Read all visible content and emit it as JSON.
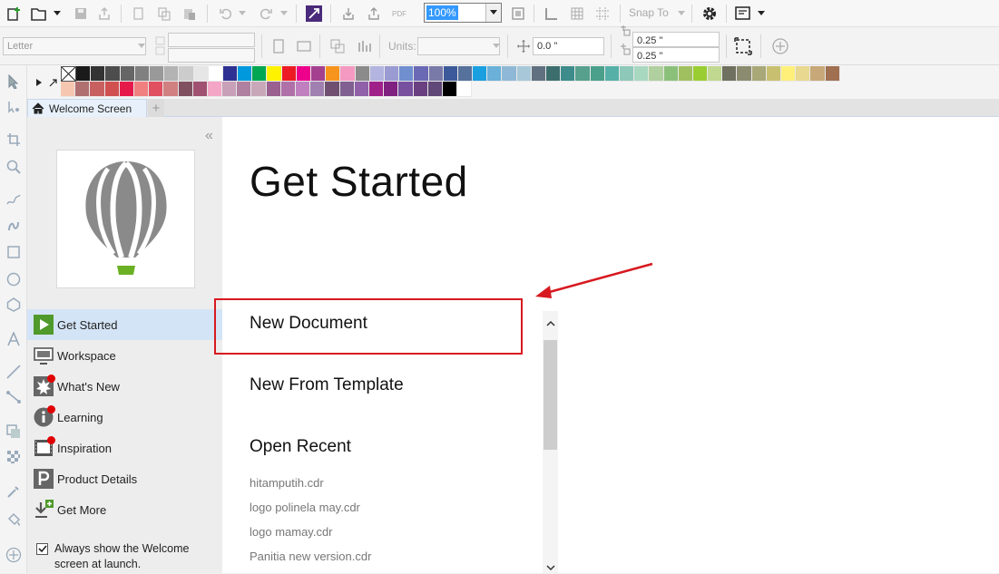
{
  "toolbar": {
    "zoom_value": "100%",
    "snap_to": "Snap To",
    "pdf_label": "PDF"
  },
  "property_bar": {
    "page_size": "Letter",
    "units_label": "Units:",
    "rotation": "0.0 \"",
    "nudge_x": "0.25 \"",
    "nudge_y": "0.25 \""
  },
  "palette": {
    "row1": [
      "#1a1a1a",
      "#333333",
      "#4d4d4d",
      "#666666",
      "#808080",
      "#999999",
      "#b3b3b3",
      "#cccccc",
      "#e6e6e6",
      "#ffffff",
      "#2e3192",
      "#0099dd",
      "#00a651",
      "#fff200",
      "#ed1c24",
      "#ec008c",
      "#a3418f",
      "#f7941d",
      "#f49ac1",
      "#8b8b8b",
      "#b4b4e0",
      "#9b9bd3",
      "#6f8fcf",
      "#6a6ab4",
      "#7a7aa8",
      "#3c5a99",
      "#56719b",
      "#1aa0e0",
      "#6ab0d8",
      "#8fb8d6",
      "#a8c8d8",
      "#607080",
      "#3c6e6e",
      "#3d8b8b",
      "#56a08d",
      "#4aa08a",
      "#56b0a8",
      "#8dc8b8",
      "#a8d8c0",
      "#b0d0a0",
      "#8bc07a",
      "#a0c060",
      "#9acd32",
      "#c0d890",
      "#707060",
      "#8b8b70",
      "#a8a878",
      "#c8c070",
      "#fff07a",
      "#e8d890",
      "#c8a878",
      "#a07050"
    ],
    "row2": [
      "#f6c7b0",
      "#b07070",
      "#c86060",
      "#d05050",
      "#e6194b",
      "#f08080",
      "#e05060",
      "#d08080",
      "#805060",
      "#a05070",
      "#f4a6c6",
      "#c8a0b8",
      "#b080a0",
      "#c8a8b8",
      "#9a6090",
      "#b070a8",
      "#c080c0",
      "#a080b0",
      "#705070",
      "#806090",
      "#9060a8",
      "#a0208a",
      "#802080",
      "#7850a0",
      "#6a4080",
      "#604878",
      "#000000",
      "#ffffff"
    ]
  },
  "tabs": {
    "welcome": "Welcome Screen"
  },
  "sidebar": {
    "items": [
      {
        "label": "Get Started"
      },
      {
        "label": "Workspace"
      },
      {
        "label": "What's New"
      },
      {
        "label": "Learning"
      },
      {
        "label": "Inspiration"
      },
      {
        "label": "Product Details"
      },
      {
        "label": "Get More"
      }
    ],
    "always_show": "Always show the Welcome screen at launch."
  },
  "main": {
    "title": "Get Started",
    "new_document": "New Document",
    "new_from_template": "New From Template",
    "open_recent": "Open Recent",
    "recent_files": [
      "hitamputih.cdr",
      "logo polinela may.cdr",
      "logo mamay.cdr",
      "Panitia new version.cdr"
    ]
  },
  "colors": {
    "accent_selected": "#d4e4f7",
    "highlight_box": "#d71920",
    "logo_gray": "#8a8a8a",
    "logo_green": "#6ab023"
  }
}
